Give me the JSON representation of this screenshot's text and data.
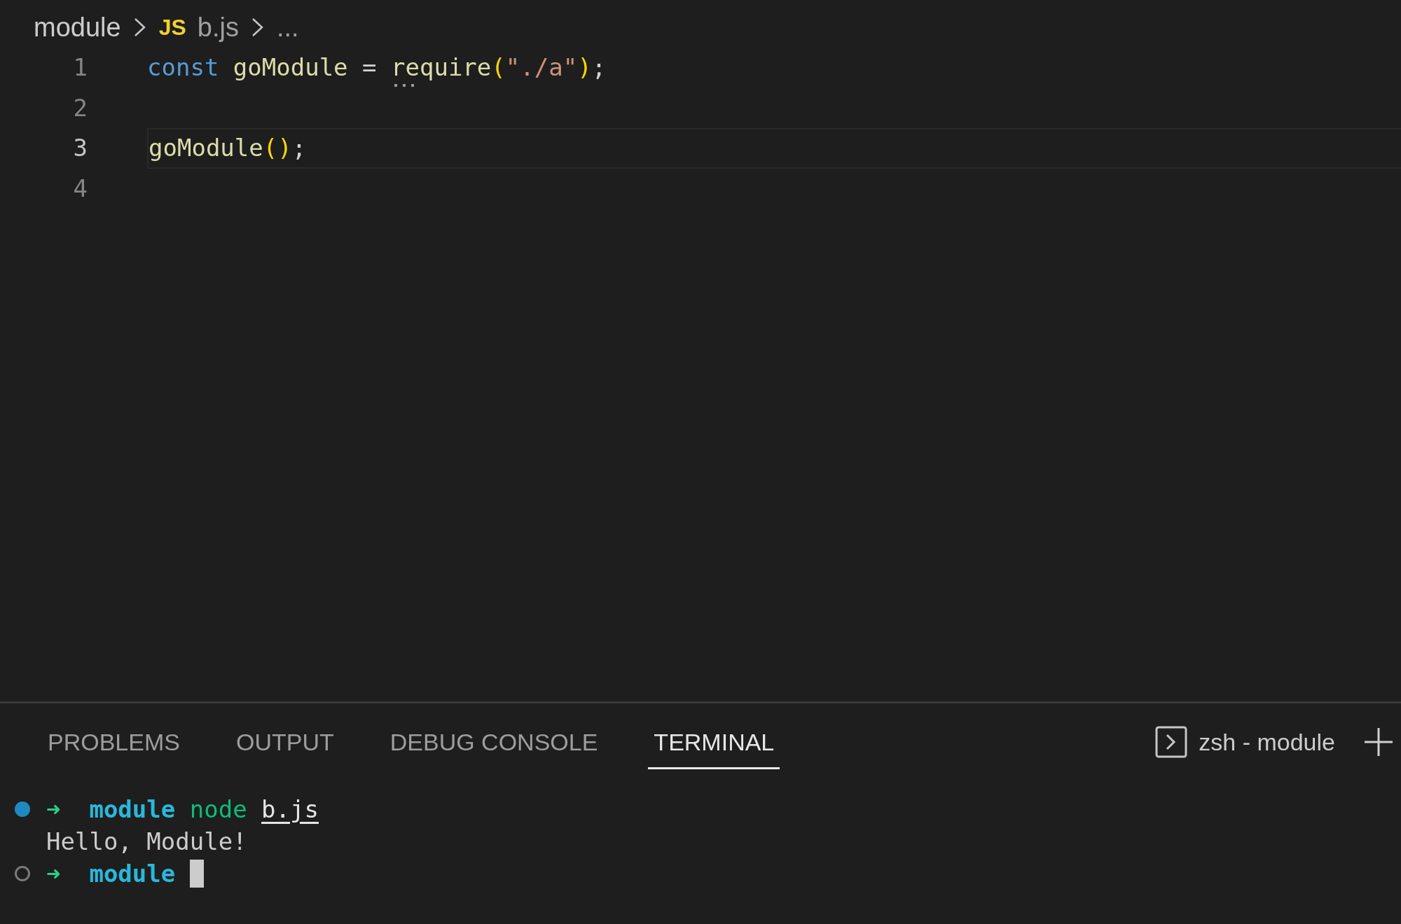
{
  "breadcrumb": [
    {
      "kind": "folder",
      "label": "module"
    },
    {
      "kind": "file",
      "badge": "JS",
      "label": "b.js"
    },
    {
      "kind": "more",
      "label": "..."
    }
  ],
  "editor": {
    "lines": [
      {
        "number": "1",
        "current": false,
        "tokens": [
          {
            "kind": "keyword",
            "text": "const"
          },
          {
            "kind": "function",
            "text": " goModule"
          },
          {
            "kind": "operator",
            "text": " = "
          },
          {
            "kind": "function",
            "text": "require",
            "hint": true
          },
          {
            "kind": "bracket",
            "text": "("
          },
          {
            "kind": "string",
            "text": "\"./a\""
          },
          {
            "kind": "bracket",
            "text": ")"
          },
          {
            "kind": "operator",
            "text": ";"
          }
        ]
      },
      {
        "number": "2",
        "current": false
      },
      {
        "number": "3",
        "current": true,
        "tokens": [
          {
            "kind": "function",
            "text": "goModule"
          },
          {
            "kind": "bracket",
            "text": "()"
          },
          {
            "kind": "operator",
            "text": ";"
          }
        ]
      },
      {
        "number": "4",
        "current": false
      }
    ]
  },
  "panel": {
    "tabs": [
      {
        "label": "PROBLEMS",
        "selected": false
      },
      {
        "label": "OUTPUT",
        "selected": false
      },
      {
        "label": "DEBUG CONSOLE",
        "selected": false
      },
      {
        "label": "TERMINAL",
        "selected": true
      }
    ],
    "terminal_name": "zsh - module"
  },
  "terminal": {
    "lines": [
      {
        "kind": "command",
        "tokens": [
          {
            "kind": "arrow",
            "text": "➜"
          },
          {
            "kind": "dir",
            "text": "  module"
          },
          {
            "kind": "cmd",
            "text": " node "
          },
          {
            "kind": "argument",
            "text": "b.js"
          }
        ]
      },
      {
        "kind": "output",
        "tokens": [
          {
            "kind": "output",
            "text": "Hello, Module!"
          }
        ]
      },
      {
        "kind": "prompt",
        "cursor": true,
        "tokens": [
          {
            "kind": "arrow",
            "text": "➜"
          },
          {
            "kind": "dir",
            "text": "  module"
          }
        ]
      }
    ]
  }
}
